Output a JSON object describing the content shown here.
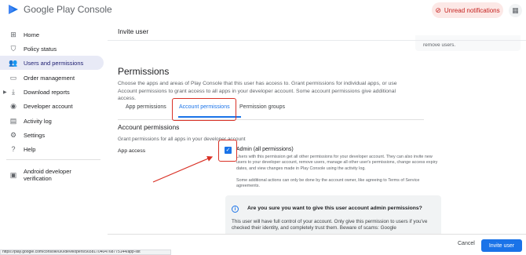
{
  "header": {
    "app_name": "Google Play Console",
    "unread_label": "Unread notifications",
    "brand_color": "#1a73e8",
    "alert_color": "#c5221f"
  },
  "sidebar": {
    "items": [
      {
        "label": "Home",
        "icon": "grid-icon"
      },
      {
        "label": "Policy status",
        "icon": "shield-icon"
      },
      {
        "label": "Users and permissions",
        "icon": "people-icon",
        "active": true
      },
      {
        "label": "Order management",
        "icon": "card-icon"
      },
      {
        "label": "Download reports",
        "icon": "download-icon"
      },
      {
        "label": "Developer account",
        "icon": "account-icon"
      },
      {
        "label": "Activity log",
        "icon": "log-icon"
      },
      {
        "label": "Settings",
        "icon": "gear-icon"
      },
      {
        "label": "Help",
        "icon": "help-icon"
      },
      {
        "label": "Android developer verification",
        "icon": "verify-icon"
      }
    ]
  },
  "main": {
    "title": "Invite user",
    "removed_text": "remove users.",
    "permissions_heading": "Permissions",
    "permissions_desc": "Choose the apps and areas of Play Console that this user has access to. Grant permissions for individual apps, or use Account permissions to grant access to all apps in your developer account. Some account permissions give additional access.",
    "tabs": [
      {
        "label": "App permissions"
      },
      {
        "label": "Account permissions",
        "active": true
      },
      {
        "label": "Permission groups"
      }
    ],
    "account_heading": "Account permissions",
    "account_sub": "Grant permissions for all apps in your developer account",
    "app_access_label": "App access",
    "admin_label": "Admin (all permissions)",
    "admin_checked": true,
    "admin_desc": "Users with this permission get all other permissions for your developer account. They can also invite new users to your developer account, remove users, manage all other user's permissions, change access expiry dates, and view changes made in Play Console using the activity log.",
    "admin_note": "Some additional actions can only be done by the account owner, like agreeing to Terms of Service agreements.",
    "warning_title": "Are you sure you want to give this user account admin permissions?",
    "warning_body": "This user will have full control of your account. Only give this permission to users if you've checked their identity, and completely trust them. Beware of scams: Google"
  },
  "footer": {
    "cancel_label": "Cancel",
    "invite_label": "Invite user"
  },
  "status_url": "https://play.google.com/console/u/0/developers/5658170404768775144/app-list"
}
